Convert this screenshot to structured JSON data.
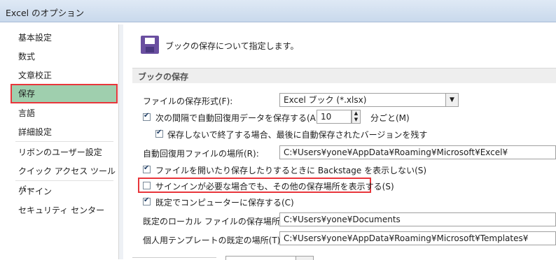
{
  "window": {
    "title": "Excel のオプション"
  },
  "sidebar": {
    "items": [
      {
        "label": "基本設定"
      },
      {
        "label": "数式"
      },
      {
        "label": "文章校正"
      },
      {
        "label": "保存"
      },
      {
        "label": "言語"
      },
      {
        "label": "詳細設定"
      },
      {
        "label": "リボンのユーザー設定"
      },
      {
        "label": "クイック アクセス ツール バー"
      },
      {
        "label": "アドイン"
      },
      {
        "label": "セキュリティ センター"
      }
    ],
    "selected": "保存"
  },
  "main": {
    "header": "ブックの保存について指定します。",
    "section_title": "ブックの保存",
    "format_label": "ファイルの保存形式(F):",
    "format_value": "Excel ブック (*.xlsx)",
    "autorecover_label": "次の間隔で自動回復用データを保存する(A):",
    "autorecover_checked": true,
    "autorecover_minutes": "10",
    "minutes_suffix": "分ごと(M)",
    "keep_last_label": "保存しないで終了する場合、最後に自動保存されたバージョンを残す",
    "keep_last_checked": true,
    "ar_location_label": "自動回復用ファイルの場所(R):",
    "ar_location_value": "C:¥Users¥yone¥AppData¥Roaming¥Microsoft¥Excel¥",
    "backstage_label": "ファイルを開いたり保存したりするときに Backstage を表示しない(S)",
    "backstage_checked": true,
    "signin_label": "サインインが必要な場合でも、その他の保存場所を表示する(S)",
    "signin_checked": false,
    "save_computer_label": "既定でコンピューターに保存する(C)",
    "save_computer_checked": true,
    "local_location_label": "既定のローカル ファイルの保存場所(I):",
    "local_location_value": "C:¥Users¥yone¥Documents",
    "template_location_label": "個人用テンプレートの既定の場所(T):",
    "template_location_value": "C:¥Users¥yone¥AppData¥Roaming¥Microsoft¥Templates¥"
  },
  "colors": {
    "selected_bg": "#9fcfae",
    "highlight_border": "#e8363b"
  }
}
